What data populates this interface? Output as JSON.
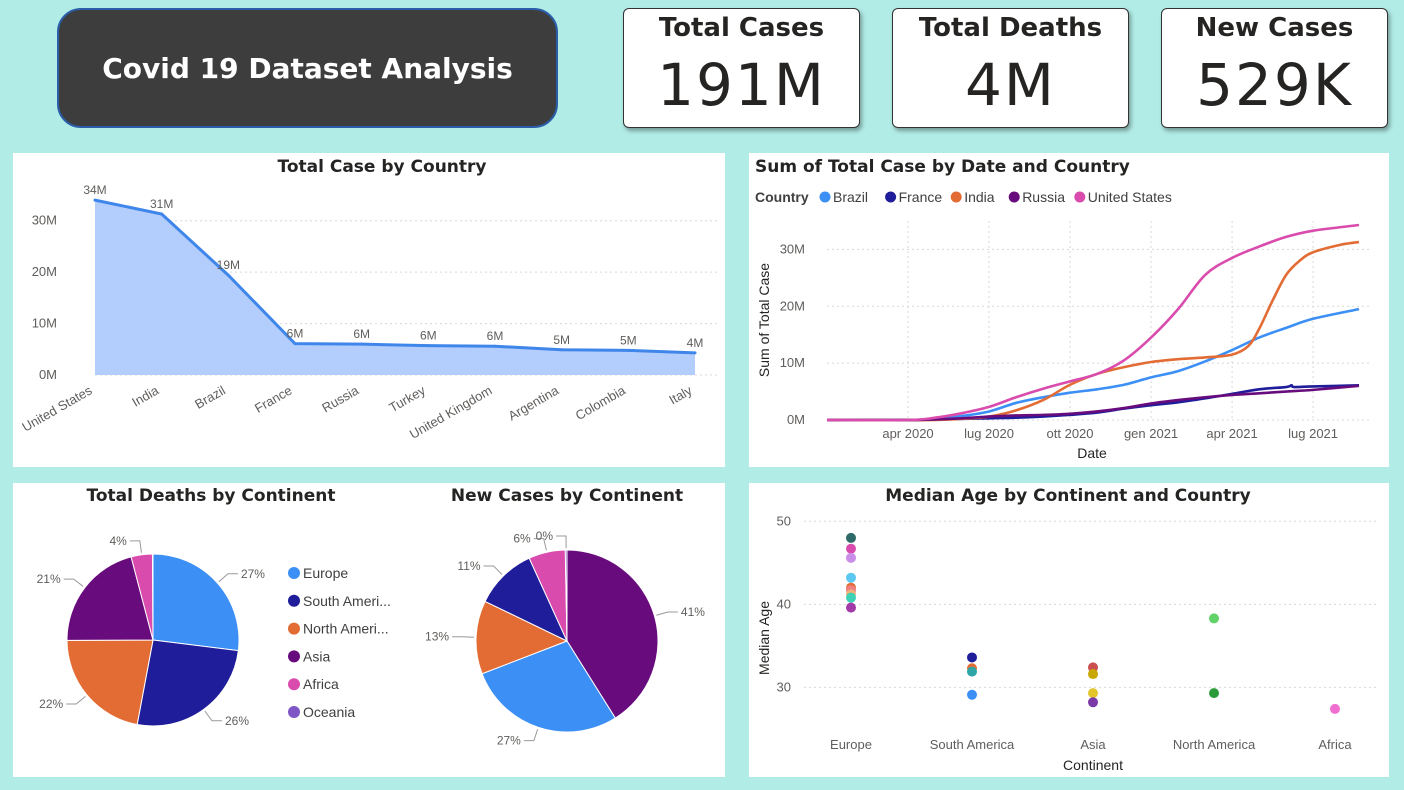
{
  "header": {
    "title": "Covid 19 Dataset Analysis"
  },
  "kpis": [
    {
      "label": "Total Cases",
      "value": "191M"
    },
    {
      "label": "Total Deaths",
      "value": "4M"
    },
    {
      "label": "New Cases",
      "value": "529K"
    }
  ],
  "colors": {
    "page_bg": "#b2ece7",
    "area_fill": "#b3cdfc",
    "area_line": "#3f86ea",
    "brazil": "#3c8ff5",
    "france": "#1f1d9a",
    "india": "#e36c35",
    "russia": "#680b7d",
    "united_states": "#d94cad"
  },
  "chart_data": [
    {
      "id": "total-case-by-country",
      "type": "area",
      "title": "Total Case by Country",
      "categories": [
        "United States",
        "India",
        "Brazil",
        "France",
        "Russia",
        "Turkey",
        "United Kingdom",
        "Argentina",
        "Colombia",
        "Italy"
      ],
      "values": [
        34,
        31.3,
        19.4,
        6.1,
        6.0,
        5.7,
        5.6,
        4.9,
        4.8,
        4.3
      ],
      "data_labels": [
        "34M",
        "31M",
        "19M",
        "6M",
        "6M",
        "6M",
        "6M",
        "5M",
        "5M",
        "4M"
      ],
      "yticks": [
        "0M",
        "10M",
        "20M",
        "30M"
      ],
      "ytick_values": [
        0,
        10,
        20,
        30
      ],
      "ylim": [
        0,
        35
      ],
      "units": "M",
      "grid": true
    },
    {
      "id": "sum-total-case-by-date-country",
      "type": "line",
      "title": "Sum of Total Case by Date and Country",
      "legend_title": "Country",
      "legend_position": "top-left",
      "xlabel": "Date",
      "ylabel": "Sum of Total Case",
      "xticks": [
        "apr 2020",
        "lug 2020",
        "ott 2020",
        "gen 2021",
        "apr 2021",
        "lug 2021"
      ],
      "x_months": [
        2,
        5,
        8,
        11,
        14,
        17
      ],
      "xlim": [
        -1,
        18.7
      ],
      "yticks": [
        "0M",
        "10M",
        "20M",
        "30M"
      ],
      "ytick_values": [
        0,
        10,
        20,
        30
      ],
      "ylim": [
        0,
        35
      ],
      "series": [
        {
          "name": "Brazil",
          "color": "#3c8ff5",
          "points": [
            [
              -1,
              0
            ],
            [
              2,
              0
            ],
            [
              3,
              0.2
            ],
            [
              4,
              0.7
            ],
            [
              5,
              1.5
            ],
            [
              6,
              3
            ],
            [
              7,
              4
            ],
            [
              8,
              4.8
            ],
            [
              9,
              5.4
            ],
            [
              10,
              6.2
            ],
            [
              11,
              7.5
            ],
            [
              12,
              8.6
            ],
            [
              13,
              10.3
            ],
            [
              14,
              12.3
            ],
            [
              15,
              14.5
            ],
            [
              16,
              16.2
            ],
            [
              17,
              17.8
            ],
            [
              18.7,
              19.5
            ]
          ]
        },
        {
          "name": "France",
          "color": "#1f1d9a",
          "points": [
            [
              -1,
              0
            ],
            [
              2,
              0
            ],
            [
              3,
              0.1
            ],
            [
              4,
              0.2
            ],
            [
              5,
              0.3
            ],
            [
              6,
              0.4
            ],
            [
              7,
              0.6
            ],
            [
              8,
              0.9
            ],
            [
              9,
              1.3
            ],
            [
              10,
              2
            ],
            [
              11,
              2.6
            ],
            [
              12,
              3.1
            ],
            [
              13,
              3.8
            ],
            [
              14,
              4.6
            ],
            [
              15,
              5.4
            ],
            [
              16,
              5.8
            ],
            [
              16.2,
              6.1
            ],
            [
              16.3,
              5.8
            ],
            [
              17,
              5.9
            ],
            [
              18.7,
              6.1
            ]
          ]
        },
        {
          "name": "India",
          "color": "#e36c35",
          "points": [
            [
              -1,
              0
            ],
            [
              2,
              0
            ],
            [
              3,
              0
            ],
            [
              4,
              0.2
            ],
            [
              5,
              0.6
            ],
            [
              6,
              1.7
            ],
            [
              7,
              3.5
            ],
            [
              8,
              6.2
            ],
            [
              9,
              8.1
            ],
            [
              10,
              9.3
            ],
            [
              11,
              10.2
            ],
            [
              12,
              10.7
            ],
            [
              13,
              11
            ],
            [
              14,
              11.5
            ],
            [
              14.6,
              13
            ],
            [
              15,
              16
            ],
            [
              15.5,
              21
            ],
            [
              16,
              25.5
            ],
            [
              16.5,
              28
            ],
            [
              17,
              29.5
            ],
            [
              18,
              30.8
            ],
            [
              18.7,
              31.3
            ]
          ]
        },
        {
          "name": "Russia",
          "color": "#680b7d",
          "points": [
            [
              -1,
              0
            ],
            [
              2,
              0
            ],
            [
              3,
              0.1
            ],
            [
              4,
              0.3
            ],
            [
              5,
              0.6
            ],
            [
              6,
              0.8
            ],
            [
              7,
              0.9
            ],
            [
              8,
              1.1
            ],
            [
              9,
              1.5
            ],
            [
              10,
              2.1
            ],
            [
              11,
              2.9
            ],
            [
              12,
              3.5
            ],
            [
              13,
              4
            ],
            [
              14,
              4.4
            ],
            [
              15,
              4.7
            ],
            [
              16,
              5
            ],
            [
              17,
              5.3
            ],
            [
              18.7,
              6
            ]
          ]
        },
        {
          "name": "United States",
          "color": "#d94cad",
          "points": [
            [
              -1,
              0
            ],
            [
              2,
              0
            ],
            [
              3,
              0.4
            ],
            [
              4,
              1.2
            ],
            [
              5,
              2.3
            ],
            [
              6,
              4
            ],
            [
              7,
              5.5
            ],
            [
              8,
              6.8
            ],
            [
              9,
              8.1
            ],
            [
              10,
              10.5
            ],
            [
              11,
              14.5
            ],
            [
              12,
              19.5
            ],
            [
              13,
              25.5
            ],
            [
              14,
              28.5
            ],
            [
              15,
              30.5
            ],
            [
              16,
              32.2
            ],
            [
              17,
              33.3
            ],
            [
              18,
              33.9
            ],
            [
              18.7,
              34.3
            ]
          ]
        }
      ]
    },
    {
      "id": "total-deaths-by-continent",
      "type": "pie",
      "title": "Total Deaths by Continent",
      "slices": [
        {
          "name": "Europe",
          "value": 27,
          "label": "27%",
          "color": "#3c8ff5"
        },
        {
          "name": "South America",
          "value": 26,
          "label": "26%",
          "color": "#1f1d9a"
        },
        {
          "name": "North America",
          "value": 22,
          "label": "22%",
          "color": "#e36c35"
        },
        {
          "name": "Asia",
          "value": 21,
          "label": "21%",
          "color": "#680b7d"
        },
        {
          "name": "Africa",
          "value": 4,
          "label": "4%",
          "color": "#d94cad"
        },
        {
          "name": "Oceania",
          "value": 0.1,
          "label": "",
          "color": "#7e56c6"
        }
      ],
      "legend": [
        "Europe",
        "South Ameri...",
        "North Ameri...",
        "Asia",
        "Africa",
        "Oceania"
      ],
      "legend_colors": [
        "#3c8ff5",
        "#1f1d9a",
        "#e36c35",
        "#680b7d",
        "#d94cad",
        "#7e56c6"
      ]
    },
    {
      "id": "new-cases-by-continent",
      "type": "pie",
      "title": "New Cases by Continent",
      "slices": [
        {
          "name": "Asia",
          "value": 41,
          "label": "41%",
          "color": "#680b7d"
        },
        {
          "name": "Europe",
          "value": 28,
          "label": "27%",
          "color": "#3c8ff5"
        },
        {
          "name": "North America",
          "value": 13,
          "label": "13%",
          "color": "#e36c35"
        },
        {
          "name": "South America",
          "value": 11,
          "label": "11%",
          "color": "#1f1d9a"
        },
        {
          "name": "Africa",
          "value": 6.5,
          "label": "6%",
          "color": "#d94cad"
        },
        {
          "name": "Oceania",
          "value": 0.3,
          "label": "0%",
          "color": "#7e56c6"
        }
      ]
    },
    {
      "id": "median-age-by-continent-country",
      "type": "scatter",
      "title": "Median Age by Continent and Country",
      "xlabel": "Continent",
      "ylabel": "Median Age",
      "categories": [
        "Europe",
        "South America",
        "Asia",
        "North America",
        "Africa"
      ],
      "yticks": [
        "30",
        "40",
        "50"
      ],
      "ytick_values": [
        30,
        40,
        50
      ],
      "ylim": [
        24.5,
        51
      ],
      "points": [
        {
          "cat": 0,
          "y": 48.0,
          "color": "#2e6b68"
        },
        {
          "cat": 0,
          "y": 46.7,
          "color": "#d94cad"
        },
        {
          "cat": 0,
          "y": 45.6,
          "color": "#c98fe8"
        },
        {
          "cat": 0,
          "y": 43.2,
          "color": "#5cc7f0"
        },
        {
          "cat": 0,
          "y": 42.0,
          "color": "#e36c35"
        },
        {
          "cat": 0,
          "y": 41.7,
          "color": "#f08080"
        },
        {
          "cat": 0,
          "y": 41.2,
          "color": "#f0b27a"
        },
        {
          "cat": 0,
          "y": 40.8,
          "color": "#3fd1b6"
        },
        {
          "cat": 0,
          "y": 39.6,
          "color": "#a23aa8"
        },
        {
          "cat": 1,
          "y": 33.6,
          "color": "#1f1d9a"
        },
        {
          "cat": 1,
          "y": 32.3,
          "color": "#e36c35"
        },
        {
          "cat": 1,
          "y": 31.9,
          "color": "#2fa5a8"
        },
        {
          "cat": 1,
          "y": 29.1,
          "color": "#3c8ff5"
        },
        {
          "cat": 2,
          "y": 32.4,
          "color": "#c94f50"
        },
        {
          "cat": 2,
          "y": 31.6,
          "color": "#c8a800"
        },
        {
          "cat": 2,
          "y": 29.3,
          "color": "#e4c52b"
        },
        {
          "cat": 2,
          "y": 28.2,
          "color": "#7b3aa8"
        },
        {
          "cat": 3,
          "y": 38.3,
          "color": "#62d26a"
        },
        {
          "cat": 3,
          "y": 29.3,
          "color": "#2c9b3a"
        },
        {
          "cat": 4,
          "y": 27.4,
          "color": "#ef6fd0"
        }
      ]
    }
  ]
}
